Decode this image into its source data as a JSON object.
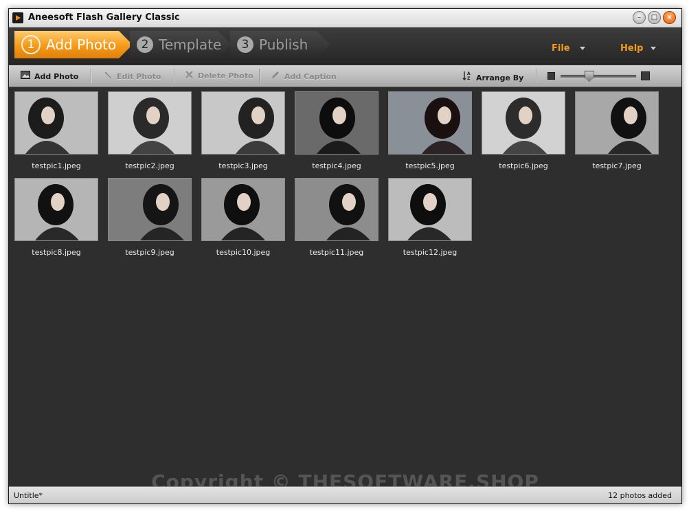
{
  "window": {
    "title": "Aneesoft Flash Gallery Classic",
    "buttons": {
      "minimize": "–",
      "maximize": "□",
      "close": "×"
    }
  },
  "wizard": {
    "steps": [
      {
        "number": "1",
        "label": "Add Photo",
        "state": "active"
      },
      {
        "number": "2",
        "label": "Template",
        "state": "inactive"
      },
      {
        "number": "3",
        "label": "Publish",
        "state": "inactive"
      }
    ],
    "menus": {
      "file": "File",
      "help": "Help"
    },
    "accent_color": "#f49a1a"
  },
  "toolbar": {
    "add_photo": "Add Photo",
    "edit_photo": "Edit Photo",
    "delete_photo": "Delete Photo",
    "add_caption": "Add Caption",
    "arrange_by": "Arrange By",
    "icons": {
      "add_photo": "add-photo-icon",
      "edit_photo": "wrench-icon",
      "delete_photo": "x-icon",
      "add_caption": "pencil-icon",
      "arrange_by": "sort-icon"
    },
    "thumbnail_size": 0.37
  },
  "gallery": {
    "photos": [
      {
        "filename": "testpic1.jpeg"
      },
      {
        "filename": "testpic2.jpeg"
      },
      {
        "filename": "testpic3.jpeg"
      },
      {
        "filename": "testpic4.jpeg"
      },
      {
        "filename": "testpic5.jpeg"
      },
      {
        "filename": "testpic6.jpeg"
      },
      {
        "filename": "testpic7.jpeg"
      },
      {
        "filename": "testpic8.jpeg"
      },
      {
        "filename": "testpic9.jpeg"
      },
      {
        "filename": "testpic10.jpeg"
      },
      {
        "filename": "testpic11.jpeg"
      },
      {
        "filename": "testpic12.jpeg"
      }
    ]
  },
  "watermark": "Copyright © THESOFTWARE.SHOP",
  "status": {
    "document": "Untitle*",
    "count": "12 photos added"
  }
}
